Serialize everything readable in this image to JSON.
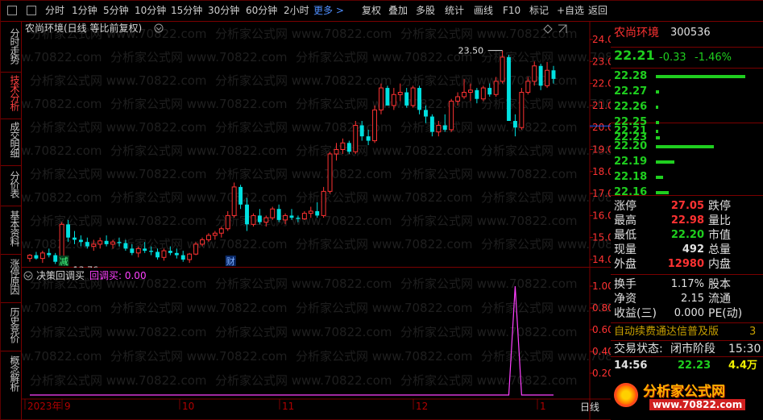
{
  "toolbar": {
    "left_items": [
      "分时",
      "1分钟",
      "5分钟",
      "10分钟",
      "15分钟",
      "30分钟",
      "60分钟",
      "2小时"
    ],
    "more": "更多 >",
    "right_items": [
      "复权",
      "叠加",
      "多股",
      "统计",
      "画线",
      "F10",
      "标记",
      "+自选",
      "返回"
    ]
  },
  "left_tabs": [
    "分时走势",
    "技术分析",
    "成交明细",
    "分价表",
    "基本资料",
    "涨停原因",
    "历史竞价",
    "概念解析"
  ],
  "chart_header": "农尚环境(日线 等比前复权)",
  "watermark": "分析家公式网 www.70822.com",
  "price_axis": [
    "24.00",
    "23.00",
    "22.00",
    "21.00",
    "20.00",
    "19.00",
    "18.00",
    "17.00",
    "16.00",
    "15.00",
    "14.00"
  ],
  "annotations": {
    "high": "23.50",
    "low": "13.76",
    "marker_jian": "减",
    "marker_cai": "财"
  },
  "indicator": {
    "name": "决策回调买",
    "label": "回调买: 0.00"
  },
  "indicator_axis": [
    "1.00",
    "0.80",
    "0.60",
    "0.40",
    "0.20"
  ],
  "date_axis": [
    "2023年",
    "9",
    "10",
    "11",
    "12",
    "1"
  ],
  "date_axis_right": "日线",
  "stock": {
    "name": "农尚环境",
    "code": "300536",
    "price": "22.21",
    "change": "-0.33",
    "pct": "-1.46%"
  },
  "order_book": {
    "sell": [
      "22.28",
      "22.27",
      "22.26",
      "22.25",
      "22.23"
    ],
    "buy": [
      "22.21",
      "22.20",
      "22.19",
      "22.18",
      "22.16"
    ],
    "sell_volumes": [
      85,
      3,
      2,
      3,
      4
    ],
    "buy_volumes": [
      2,
      55,
      18,
      7,
      12
    ]
  },
  "quotes": {
    "zhangting_l": "涨停",
    "zhangting_v": "27.05",
    "dieting_l": "跌停",
    "zuigao_l": "最高",
    "zuigao_v": "22.98",
    "liangbi_l": "量比",
    "zuidi_l": "最低",
    "zuidi_v": "22.20",
    "shizhi_l": "市值",
    "xianliang_l": "现量",
    "xianliang_v": "492",
    "zongliang_l": "总量",
    "waipan_l": "外盘",
    "waipan_v": "12980",
    "neipan_l": "内盘",
    "huanshou_l": "换手",
    "huanshou_v": "1.17%",
    "guben_l": "股本",
    "jingzi_l": "净资",
    "jingzi_v": "2.15",
    "liutong_l": "流通",
    "shouyi_l": "收益(三)",
    "shouyi_v": "0.000",
    "pe_l": "PE(动)"
  },
  "banner": {
    "text": "自动续费通达信普及版",
    "num": "3"
  },
  "trade_status": {
    "label": "交易状态:",
    "value": "闭市阶段",
    "time": "15:30"
  },
  "tick": {
    "time": "14:56",
    "price": "22.23",
    "vol": "4.4万"
  },
  "logo": {
    "title": "分析家公式网",
    "url": "www.70822.com"
  },
  "colors": {
    "up": "#ff3232",
    "down": "#00e0e0",
    "green": "#1fcf1f",
    "magenta": "#ff40ff",
    "yellow": "#f0f000",
    "gold": "#c8a000"
  },
  "candles": [
    [
      14.05,
      14.25,
      13.9,
      14.2
    ],
    [
      14.2,
      14.35,
      14.0,
      14.05
    ],
    [
      14.05,
      14.4,
      13.85,
      14.3
    ],
    [
      14.3,
      14.5,
      14.1,
      14.2
    ],
    [
      14.2,
      14.3,
      13.8,
      13.9
    ],
    [
      13.9,
      15.7,
      13.76,
      15.6
    ],
    [
      15.6,
      15.8,
      14.8,
      15.0
    ],
    [
      15.0,
      15.3,
      14.7,
      14.9
    ],
    [
      14.9,
      15.1,
      14.6,
      14.8
    ],
    [
      14.8,
      15.0,
      14.5,
      14.6
    ],
    [
      14.6,
      14.9,
      14.4,
      14.7
    ],
    [
      14.7,
      15.0,
      14.5,
      14.85
    ],
    [
      14.85,
      15.1,
      14.6,
      14.7
    ],
    [
      14.7,
      14.9,
      14.5,
      14.8
    ],
    [
      14.8,
      15.0,
      14.6,
      14.75
    ],
    [
      14.75,
      14.9,
      14.4,
      14.5
    ],
    [
      14.5,
      14.7,
      14.2,
      14.3
    ],
    [
      14.3,
      14.6,
      14.1,
      14.5
    ],
    [
      14.5,
      14.8,
      14.3,
      14.4
    ],
    [
      14.4,
      14.6,
      14.2,
      14.35
    ],
    [
      14.35,
      14.5,
      14.0,
      14.1
    ],
    [
      14.1,
      14.5,
      13.95,
      14.4
    ],
    [
      14.4,
      14.6,
      14.2,
      14.3
    ],
    [
      14.3,
      14.5,
      14.05,
      14.2
    ],
    [
      14.2,
      14.4,
      13.9,
      14.0
    ],
    [
      14.0,
      14.3,
      13.85,
      14.25
    ],
    [
      14.25,
      14.8,
      14.2,
      14.7
    ],
    [
      14.7,
      15.0,
      14.6,
      14.9
    ],
    [
      14.9,
      15.2,
      14.8,
      15.1
    ],
    [
      15.1,
      15.3,
      14.9,
      15.2
    ],
    [
      15.2,
      15.5,
      15.0,
      15.4
    ],
    [
      15.4,
      16.2,
      15.3,
      16.0
    ],
    [
      16.0,
      17.5,
      15.9,
      17.3
    ],
    [
      17.3,
      17.4,
      16.3,
      16.5
    ],
    [
      16.5,
      16.8,
      15.3,
      15.6
    ],
    [
      15.6,
      16.1,
      15.5,
      16.0
    ],
    [
      16.0,
      16.3,
      15.6,
      15.7
    ],
    [
      15.7,
      16.0,
      15.5,
      15.9
    ],
    [
      15.9,
      16.4,
      15.8,
      16.3
    ],
    [
      16.3,
      16.5,
      15.7,
      15.8
    ],
    [
      15.8,
      16.1,
      15.6,
      16.0
    ],
    [
      16.0,
      16.3,
      15.8,
      15.9
    ],
    [
      15.9,
      16.0,
      15.7,
      15.85
    ],
    [
      15.85,
      16.2,
      15.8,
      16.1
    ],
    [
      16.1,
      16.4,
      15.9,
      16.2
    ],
    [
      16.2,
      16.6,
      15.9,
      16.0
    ],
    [
      16.0,
      17.3,
      15.9,
      17.1
    ],
    [
      17.1,
      18.9,
      17.0,
      18.8
    ],
    [
      18.8,
      19.3,
      18.5,
      19.0
    ],
    [
      19.0,
      19.5,
      18.8,
      19.3
    ],
    [
      19.3,
      19.4,
      18.8,
      18.9
    ],
    [
      18.9,
      20.3,
      18.8,
      20.1
    ],
    [
      20.1,
      20.3,
      19.4,
      19.6
    ],
    [
      19.6,
      19.9,
      19.2,
      19.4
    ],
    [
      19.4,
      21.0,
      19.3,
      20.8
    ],
    [
      20.8,
      22.0,
      20.6,
      21.8
    ],
    [
      21.8,
      21.9,
      21.2,
      21.0
    ],
    [
      21.0,
      21.8,
      20.8,
      21.5
    ],
    [
      21.5,
      22.0,
      21.2,
      21.6
    ],
    [
      21.6,
      21.8,
      20.9,
      21.0
    ],
    [
      21.0,
      21.9,
      20.9,
      21.8
    ],
    [
      21.8,
      21.9,
      20.6,
      20.8
    ],
    [
      20.8,
      21.0,
      20.2,
      20.5
    ],
    [
      20.5,
      20.6,
      19.6,
      19.8
    ],
    [
      19.8,
      20.3,
      19.6,
      20.1
    ],
    [
      20.1,
      20.6,
      19.8,
      19.9
    ],
    [
      19.9,
      21.3,
      19.8,
      21.2
    ],
    [
      21.2,
      21.6,
      21.0,
      21.4
    ],
    [
      21.4,
      22.2,
      21.3,
      21.6
    ],
    [
      21.6,
      22.0,
      21.2,
      21.7
    ],
    [
      21.7,
      21.8,
      21.1,
      21.3
    ],
    [
      21.3,
      21.9,
      21.2,
      21.8
    ],
    [
      21.8,
      22.0,
      21.4,
      21.5
    ],
    [
      21.5,
      22.3,
      21.4,
      22.1
    ],
    [
      22.1,
      23.5,
      22.0,
      23.2
    ],
    [
      23.2,
      23.3,
      21.0,
      20.3
    ],
    [
      20.3,
      20.6,
      19.6,
      20.0
    ],
    [
      20.0,
      21.8,
      19.9,
      21.6
    ],
    [
      21.6,
      22.3,
      21.5,
      22.1
    ],
    [
      22.1,
      23.0,
      21.9,
      22.8
    ],
    [
      22.8,
      22.9,
      21.7,
      21.9
    ],
    [
      21.9,
      22.98,
      21.8,
      22.6
    ],
    [
      22.6,
      22.8,
      22.0,
      22.21
    ]
  ],
  "indicator_values": [
    0,
    0,
    0,
    0,
    0,
    0,
    0,
    0,
    0,
    0,
    0,
    0,
    0,
    0,
    0,
    0,
    0,
    0,
    0,
    0,
    0,
    0,
    0,
    0,
    0,
    0,
    0,
    0,
    0,
    0,
    0,
    0,
    0,
    0,
    0,
    0,
    0,
    0,
    0,
    0,
    0,
    0,
    0,
    0,
    0,
    0,
    0,
    0,
    0,
    0,
    0,
    0,
    0,
    0,
    0,
    0,
    0,
    0,
    0,
    0,
    0,
    0,
    0,
    0,
    0,
    0,
    0,
    0,
    0,
    0,
    0,
    0,
    0,
    0,
    0,
    0,
    1,
    0,
    0,
    0,
    0,
    0,
    0
  ]
}
